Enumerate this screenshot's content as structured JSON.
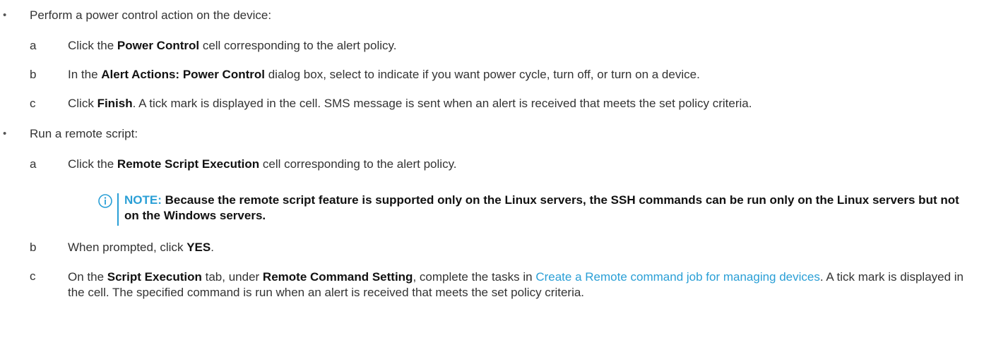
{
  "bullets": [
    {
      "symbol": "•",
      "text": "Perform a power control action on the device:"
    },
    {
      "symbol": "•",
      "text": "Run a remote script:"
    }
  ],
  "power_steps": [
    {
      "letter": "a",
      "pre": "Click the ",
      "bold": "Power Control",
      "post": " cell corresponding to the alert policy."
    },
    {
      "letter": "b",
      "pre": "In the ",
      "bold": "Alert Actions: Power Control",
      "post": " dialog box, select to indicate if you want power cycle, turn off, or turn on a device."
    },
    {
      "letter": "c",
      "pre": "Click ",
      "bold": "Finish",
      "post": ". A tick mark is displayed in the cell. SMS message is sent when an alert is received that meets the set policy criteria."
    }
  ],
  "script_steps": {
    "a": {
      "letter": "a",
      "pre": "Click the ",
      "bold": "Remote Script Execution",
      "post": " cell corresponding to the alert policy."
    },
    "b": {
      "letter": "b",
      "pre": "When prompted, click ",
      "bold": "YES",
      "post": "."
    },
    "c": {
      "letter": "c",
      "pre": "On the ",
      "bold1": "Script Execution",
      "mid": " tab, under ",
      "bold2": "Remote Command Setting",
      "mid2": ", complete the tasks in ",
      "link": "Create a Remote command job for managing devices",
      "post": ". A tick mark is displayed in the cell. The specified command is run when an alert is received that meets the set policy criteria."
    }
  },
  "note": {
    "label": "NOTE:",
    "text": "Because the remote script feature is supported only on the Linux servers, the SSH commands can be run only on the Linux servers but not on the Windows servers.",
    "icon": "info-icon",
    "accent_color": "#2a9fd6"
  }
}
